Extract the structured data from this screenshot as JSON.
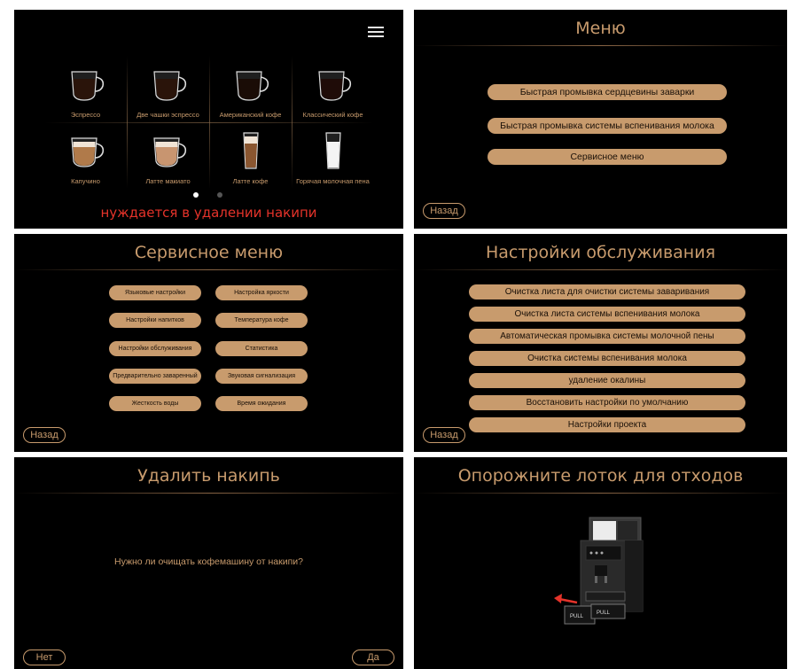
{
  "home": {
    "drinks": [
      {
        "label": "Эспрессо",
        "color": "#2a140a"
      },
      {
        "label": "Две чашки эспрессо",
        "color": "#2a140a"
      },
      {
        "label": "Американский кофе",
        "color": "#1a0c06"
      },
      {
        "label": "Классический кофе",
        "color": "#1f0c08"
      },
      {
        "label": "Капучино",
        "color": "#b07a4a"
      },
      {
        "label": "Латте макиато",
        "color": "#c89570"
      },
      {
        "label": "Латте кофе",
        "color": "#8a5630"
      },
      {
        "label": "Горячая молочная пена",
        "color": "#f4f4f4"
      }
    ],
    "warning": "нуждается в удалении накипи",
    "warning_color": "#e5332a",
    "menu_icon": "hamburger-icon"
  },
  "menu": {
    "title": "Меню",
    "items": [
      "Быстрая промывка сердцевины заварки",
      "Быстрая промывка системы вспенивания молока",
      "Сервисное меню"
    ],
    "back": "Назад"
  },
  "service": {
    "title": "Сервисное меню",
    "left": [
      "Языковые настройки",
      "Настройки напитков",
      "Настройки обслуживания",
      "Предварительно заваренный",
      "Жесткость воды"
    ],
    "right": [
      "Настройка яркости",
      "Температура кофе",
      "Статистика",
      "Звуковая сигнализация",
      "Время ожидания"
    ],
    "back": "Назад"
  },
  "maintenance": {
    "title": "Настройки обслуживания",
    "items": [
      "Очистка листа для очистки системы заваривания",
      "Очистка листа системы вспенивания молока",
      "Автоматическая промывка системы молочной пены",
      "Очистка системы вспенивания молока",
      "удаление окалины",
      "Восстановить настройки по умолчанию",
      "Настройки проекта"
    ],
    "back": "Назад"
  },
  "descale": {
    "title": "Удалить накипь",
    "question": "Нужно ли очищать кофемашину от накипи?",
    "no": "Нет",
    "yes": "Да"
  },
  "waste": {
    "title": "Опорожните лоток для отходов",
    "pull_label": "PULL",
    "arrow_color": "#e5332a"
  }
}
